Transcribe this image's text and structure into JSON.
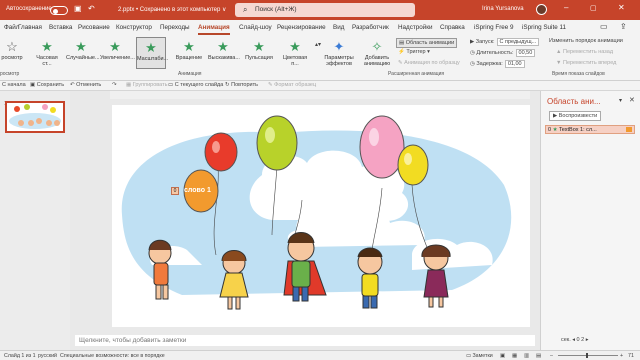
{
  "titlebar": {
    "autosave": "Автосохранение",
    "filename": "2.pptx • Сохранено в этот компьютер ∨",
    "search_placeholder": "Поиск (Alt+Ж)",
    "user": "Irina Yursanova"
  },
  "tabs": [
    "Файл",
    "Главная",
    "Вставка",
    "Рисование",
    "Конструктор",
    "Переходы",
    "Анимация",
    "Слайд-шоу",
    "Рецензирование",
    "Вид",
    "Разработчик",
    "Надстройки",
    "Справка",
    "iSpring Free 9",
    "iSpring Suite 11"
  ],
  "ribbon": {
    "preview": "росмотр",
    "effects": [
      "Часовая ст...",
      "Случайные...",
      "Увеличение...",
      "Масштаби...",
      "Вращение",
      "Выскакива...",
      "Пульсация",
      "Цветовая п..."
    ],
    "effect_params": "Параметры эффектов",
    "add_animation": "Добавить анимацию",
    "animation_area": "Область анимации",
    "trigger": "Триггер",
    "painter": "Анимация по образцу",
    "start_label": "Запуск:",
    "start_value": "С предыдущ...",
    "duration_label": "Длительность:",
    "duration_value": "00,50",
    "delay_label": "Задержка:",
    "delay_value": "01,00",
    "reorder": "Изменить порядок анимации",
    "move_earlier": "Переместить назад",
    "move_later": "Переместить вперед",
    "groups": {
      "preview": "росмотр",
      "animation": "Анимация",
      "advanced": "Расширенная анимация",
      "timing": "Время показа слайдов"
    }
  },
  "qat": {
    "from_start": "С начала",
    "save": "Сохранить",
    "undo": "Отменить",
    "redo": "",
    "group": "Группировать",
    "from_current": "С текущего слайда",
    "repeat": "Повторить",
    "format_painter": "Формат образец"
  },
  "slide": {
    "thumb_number": "1",
    "text_box": "слово 1",
    "badge": "0",
    "notes_placeholder": "Щелкните, чтобы добавить заметки"
  },
  "anipane": {
    "title": "Область ани...",
    "play": "Воспроизвести",
    "item_number": "0",
    "item_label": "TextBox 1: сл..."
  },
  "status": {
    "slide": "Слайд 1 из 1",
    "language": "русский",
    "accessibility": "Специальные возможности: все в порядке",
    "notes": "Заметки",
    "zoom": "71"
  },
  "colors": {
    "accent": "#c6442a",
    "tab_active": "#b7472a",
    "star": "#3a9b5b",
    "sky": "#bfe0f3"
  }
}
